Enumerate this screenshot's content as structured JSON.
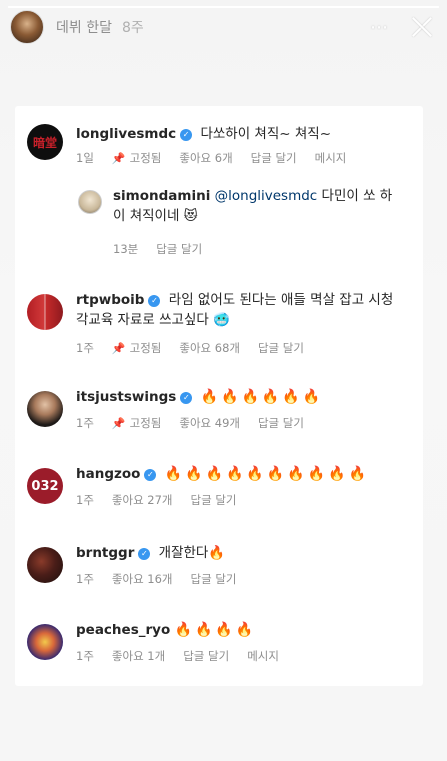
{
  "story": {
    "username": "데뷔 한달",
    "time": "8주",
    "more_icon": "⋯",
    "progress": 1.0
  },
  "comments": [
    {
      "username": "longlivesmdc",
      "verified": true,
      "text": "다쏘하이 쳐직~ 쳐직~",
      "time": "1일",
      "pinned": "고정됨",
      "likes": "좋아요 6개",
      "reply": "답글 달기",
      "message": "메시지"
    },
    {
      "username": "simondamini",
      "mention": "@longlivesmdc",
      "text_line1": "다민이 쏘 하",
      "text_line2": "이 쳐직이네 😻",
      "time": "13분",
      "reply": "답글 달기"
    },
    {
      "username": "rtpwboib",
      "verified": true,
      "text_line1": "라임 없어도 된다는 애들 멱살 잡고 시청",
      "text_line2": "각교육 자료로 쓰고싶다 🥶",
      "time": "1주",
      "pinned": "고정됨",
      "likes": "좋아요 68개",
      "reply": "답글 달기"
    },
    {
      "username": "itsjustswings",
      "verified": true,
      "text": "🔥🔥🔥🔥🔥🔥",
      "time": "1주",
      "pinned": "고정됨",
      "likes": "좋아요 49개",
      "reply": "답글 달기"
    },
    {
      "username": "hangzoo",
      "verified": true,
      "text": "🔥🔥🔥🔥🔥🔥🔥🔥🔥🔥",
      "time": "1주",
      "likes": "좋아요 27개",
      "reply": "답글 달기"
    },
    {
      "username": "brntggr",
      "verified": true,
      "text": "개잘한다🔥",
      "time": "1주",
      "likes": "좋아요 16개",
      "reply": "답글 달기"
    },
    {
      "username": "peaches_ryo",
      "text": "🔥🔥🔥🔥",
      "time": "1주",
      "likes": "좋아요 1개",
      "reply": "답글 달기",
      "message": "메시지"
    }
  ],
  "avatar_labels": {
    "longlivesmdc": "暗堂",
    "hangzoo": "032"
  },
  "colors": {
    "verified": "#3897f0",
    "meta": "#8e8e8e",
    "mention": "#00376b"
  }
}
